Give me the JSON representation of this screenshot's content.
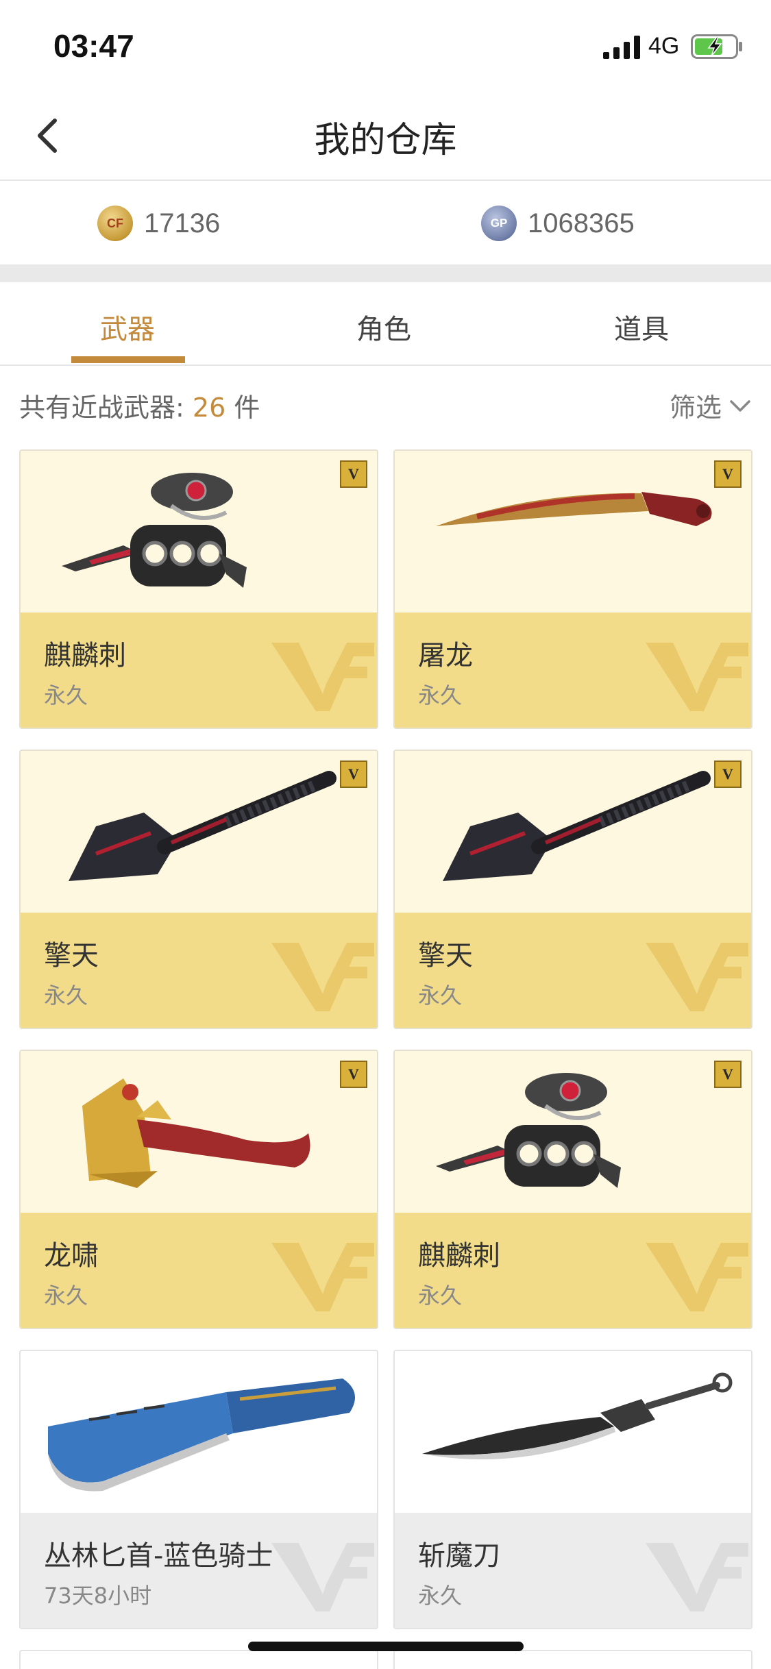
{
  "status_bar": {
    "time": "03:47",
    "network": "4G"
  },
  "nav": {
    "title": "我的仓库"
  },
  "currency": {
    "cf_amount": "17136",
    "gp_amount": "1068365",
    "cf_coin_label": "CF",
    "gp_coin_label": "GP"
  },
  "tabs": [
    {
      "label": "武器",
      "active": true
    },
    {
      "label": "角色",
      "active": false
    },
    {
      "label": "道具",
      "active": false
    }
  ],
  "summary": {
    "prefix": "共有近战武器: ",
    "count": "26",
    "suffix": " 件",
    "filter_label": "筛选"
  },
  "items": [
    {
      "name": "麒麟刺",
      "duration": "永久",
      "vip": true,
      "badge": "V",
      "style": "gold",
      "icon": "knuckle-blade-icon"
    },
    {
      "name": "屠龙",
      "duration": "永久",
      "vip": true,
      "badge": "V",
      "style": "gold",
      "icon": "curved-blade-icon"
    },
    {
      "name": "擎天",
      "duration": "永久",
      "vip": true,
      "badge": "V",
      "style": "gold",
      "icon": "spade-blade-icon"
    },
    {
      "name": "擎天",
      "duration": "永久",
      "vip": true,
      "badge": "V",
      "style": "gold",
      "icon": "spade-blade-icon"
    },
    {
      "name": "龙啸",
      "duration": "永久",
      "vip": true,
      "badge": "V",
      "style": "gold",
      "icon": "dragon-axe-icon"
    },
    {
      "name": "麒麟刺",
      "duration": "永久",
      "vip": true,
      "badge": "V",
      "style": "gold",
      "icon": "knuckle-blade-icon"
    },
    {
      "name": "丛林匕首-蓝色骑士",
      "duration": "73天8小时",
      "vip": false,
      "style": "grey",
      "icon": "jungle-knife-icon"
    },
    {
      "name": "斩魔刀",
      "duration": "永久",
      "vip": false,
      "style": "grey",
      "icon": "demon-sword-icon"
    }
  ],
  "colors": {
    "accent": "#c48a3c",
    "gold_card": "#f2dc8a",
    "gold_card_top": "#fff8e0",
    "grey_card": "#ececec"
  }
}
